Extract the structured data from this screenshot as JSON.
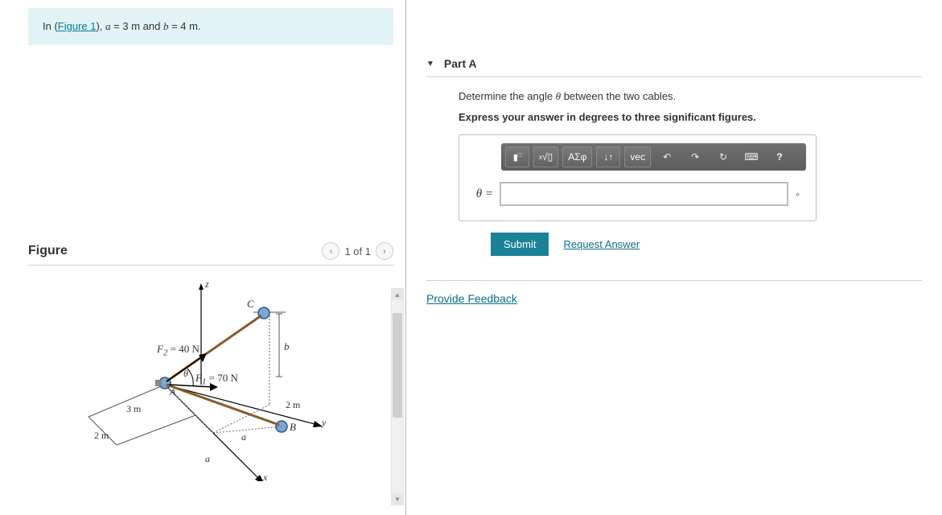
{
  "problem": {
    "intro_prefix": "In (",
    "figure_link": "Figure 1",
    "intro_suffix": "), ",
    "var_a": "a",
    "val_a": " = 3 m",
    "intro_and": " and ",
    "var_b": "b",
    "val_b": " = 4 m."
  },
  "figure": {
    "title": "Figure",
    "pager_text": "1 of 1",
    "labels": {
      "z": "z",
      "C": "C",
      "F2": "F",
      "F2sub": "2",
      "F2val": " = 40 N",
      "b": "b",
      "theta": "θ",
      "F1": "F",
      "F1sub": "1",
      "F1val": " = 70 N",
      "A": "A",
      "d2m_right": "2 m",
      "y": "y",
      "B": "B",
      "d3m": "3 m",
      "d2m_left": "2 m",
      "a1": "a",
      "a2": "a",
      "x": "x"
    }
  },
  "part": {
    "label": "Part A",
    "question": "Determine the angle θ between the two cables.",
    "instruction": "Express your answer in degrees to three significant figures.",
    "input_label": "θ =",
    "input_value": "",
    "unit": "∘",
    "toolbar": {
      "templates": "▮",
      "root": "√̅",
      "greek": "ΑΣφ",
      "scripts": "↓↑",
      "vec": "vec",
      "undo": "↶",
      "redo": "↷",
      "reset": "↻",
      "keyboard": "⌨",
      "help": "?"
    },
    "submit": "Submit",
    "request": "Request Answer"
  },
  "feedback": {
    "link": "Provide Feedback"
  }
}
